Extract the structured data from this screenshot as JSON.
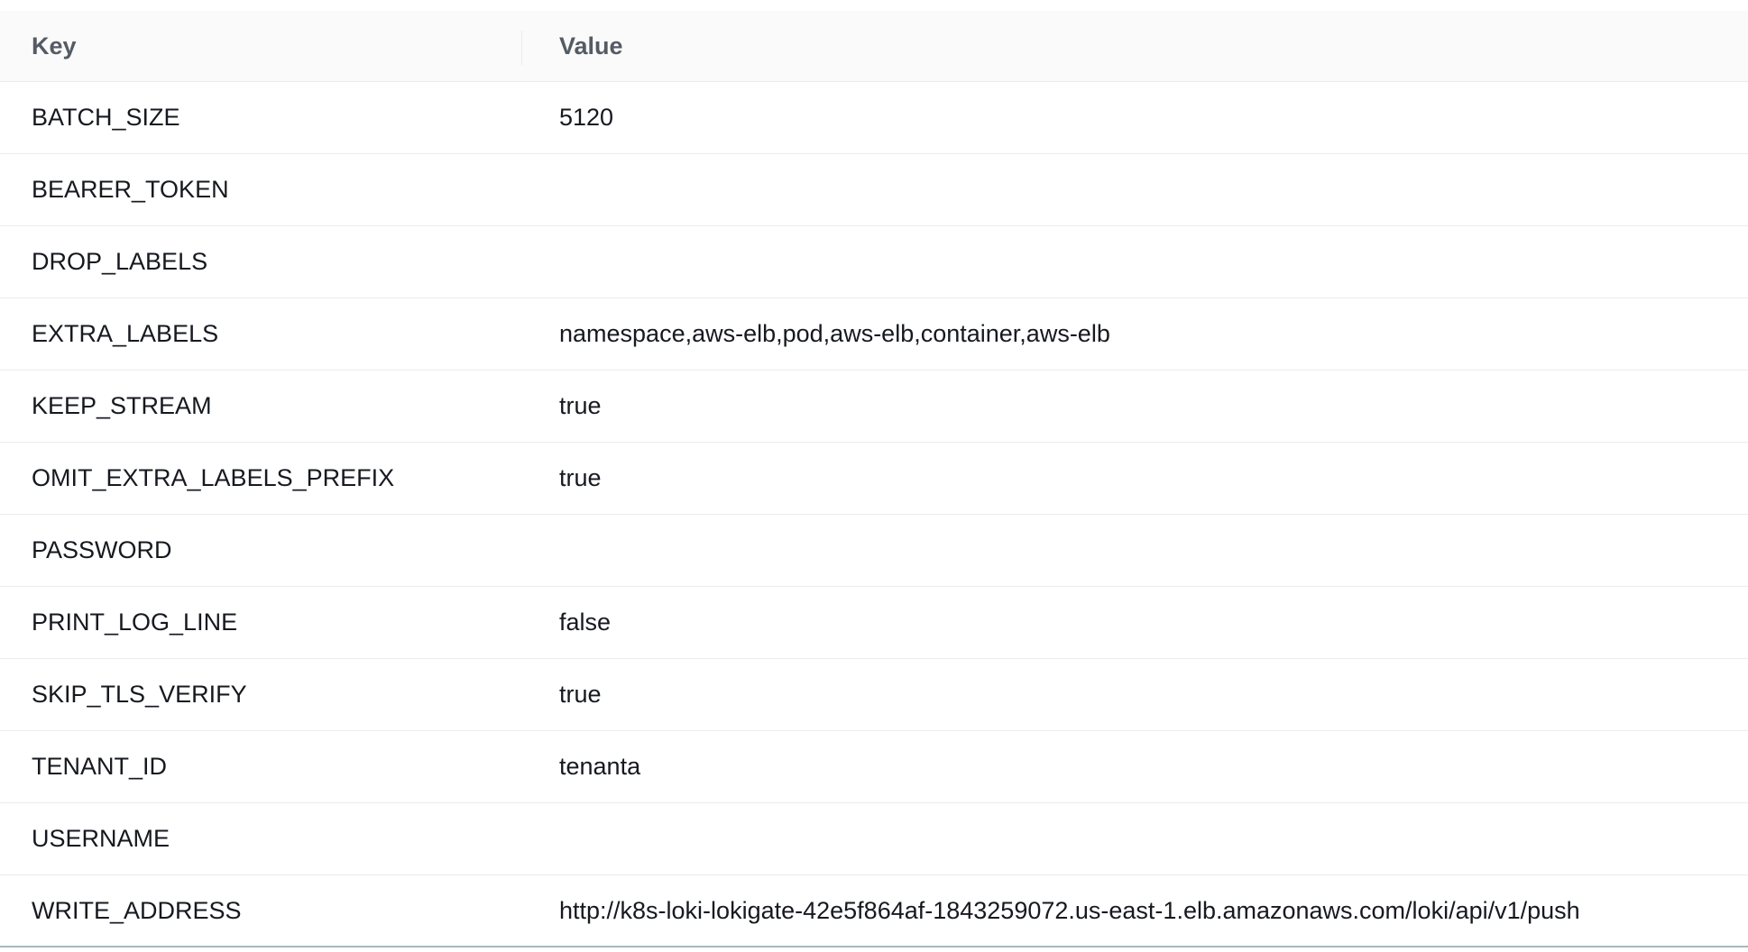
{
  "table": {
    "columns": {
      "key": "Key",
      "value": "Value"
    },
    "rows": [
      {
        "key": "BATCH_SIZE",
        "value": "5120"
      },
      {
        "key": "BEARER_TOKEN",
        "value": ""
      },
      {
        "key": "DROP_LABELS",
        "value": ""
      },
      {
        "key": "EXTRA_LABELS",
        "value": "namespace,aws-elb,pod,aws-elb,container,aws-elb"
      },
      {
        "key": "KEEP_STREAM",
        "value": "true"
      },
      {
        "key": "OMIT_EXTRA_LABELS_PREFIX",
        "value": "true"
      },
      {
        "key": "PASSWORD",
        "value": ""
      },
      {
        "key": "PRINT_LOG_LINE",
        "value": "false"
      },
      {
        "key": "SKIP_TLS_VERIFY",
        "value": "true"
      },
      {
        "key": "TENANT_ID",
        "value": "tenanta"
      },
      {
        "key": "USERNAME",
        "value": ""
      },
      {
        "key": "WRITE_ADDRESS",
        "value": "http://k8s-loki-lokigate-42e5f864af-1843259072.us-east-1.elb.amazonaws.com/loki/api/v1/push"
      }
    ]
  }
}
